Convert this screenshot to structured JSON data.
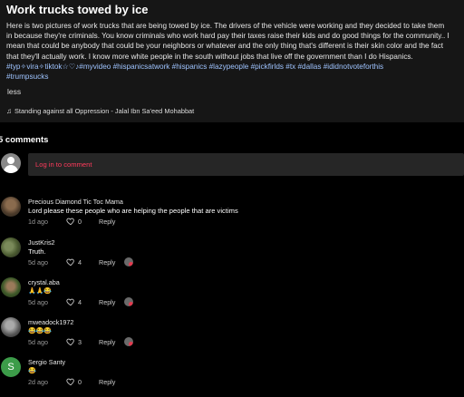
{
  "post": {
    "title": "Work trucks towed by ice",
    "caption_lines": [
      "Here is two pictures of work trucks that are being towed by ice. The drivers of the vehicle were working and they decided to take them",
      "in because they're criminals. You know criminals who work hard pay their taxes raise their kids and do good things for the community.. I",
      "mean that could be anybody that could be your neighbors or whatever and the only thing that's different is their skin color and the fact",
      "that they'll actually work. I know more white people in the south without jobs that live off the government than I do Hispanics."
    ],
    "hashtags_line1": "#typ✧vira✧tiktok☆♡♪#myvideo #hispanicsatwork #hispanics #lazypeople #pickfirlds #tx #dallas #ididnotvoteforthis",
    "hashtags_line2": "#trumpsucks",
    "less_label": "less",
    "sound": "Standing against all Oppression - Jalal Ibn Sa'eed Mohabbat"
  },
  "comments_header": "5 comments",
  "login_prompt": "Log in to comment",
  "comments": [
    {
      "username": "Precious Diamond Tic Toc Mama",
      "text": "Lord please these people who are helping the people that are victims",
      "date": "1d ago",
      "likes": "0",
      "reply": "Reply",
      "creator_liked": false
    },
    {
      "username": "JustKris2",
      "text": "Truth.",
      "date": "5d ago",
      "likes": "4",
      "reply": "Reply",
      "creator_liked": true
    },
    {
      "username": "crystal.aba",
      "text": "🙏🙏😂",
      "date": "5d ago",
      "likes": "4",
      "reply": "Reply",
      "creator_liked": true
    },
    {
      "username": "mweadock1972",
      "text": "😂😂😂",
      "date": "5d ago",
      "likes": "3",
      "reply": "Reply",
      "creator_liked": true
    },
    {
      "username": "Sergio Santy",
      "text": "😂",
      "date": "2d ago",
      "likes": "0",
      "reply": "Reply",
      "creator_liked": false
    }
  ],
  "avatar_initial_last": "S",
  "colors": {
    "accent": "#ff3b5c",
    "hashtag": "#9fc4ff",
    "background": "#000000",
    "panel": "#161616"
  },
  "icons": [
    "music-note-icon",
    "default-avatar-icon",
    "heart-outline-icon"
  ]
}
